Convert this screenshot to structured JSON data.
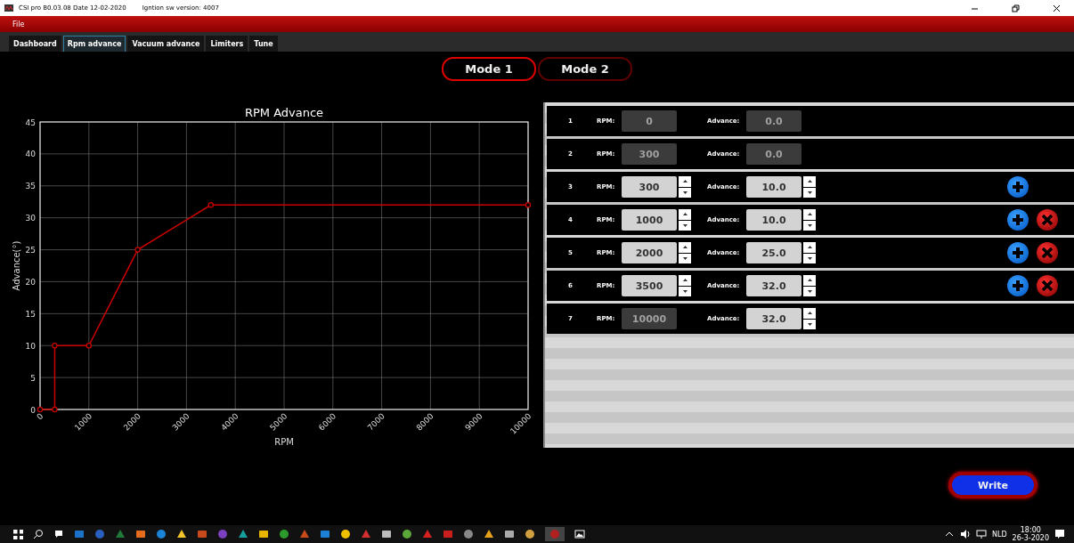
{
  "window": {
    "title": "CSI pro B0.03.08 Date 12-02-2020",
    "version": "Igntion sw version: 4007"
  },
  "menu": [
    "File"
  ],
  "tabs": [
    {
      "label": "Dashboard",
      "selected": false
    },
    {
      "label": "Rpm advance",
      "selected": true
    },
    {
      "label": "Vacuum advance",
      "selected": false
    },
    {
      "label": "Limiters",
      "selected": false
    },
    {
      "label": "Tune",
      "selected": false
    }
  ],
  "modes": [
    {
      "label": "Mode 1",
      "selected": true
    },
    {
      "label": "Mode 2",
      "selected": false
    }
  ],
  "chart": {
    "chart_data": {
      "type": "line",
      "title": "RPM Advance",
      "xlabel": "RPM",
      "ylabel": "Advance(°)",
      "x": [
        0,
        300,
        300,
        1000,
        2000,
        3500,
        10000
      ],
      "series": [
        {
          "color": "#cc0000",
          "marker": "circle",
          "values": [
            0,
            0,
            10,
            10,
            25,
            32,
            32
          ]
        }
      ],
      "grid": true,
      "xlim": [
        0,
        10000
      ],
      "ylim": [
        0,
        45
      ],
      "xticks": [
        0,
        1000,
        2000,
        3000,
        4000,
        5000,
        6000,
        7000,
        8000,
        9000,
        10000
      ],
      "yticks": [
        0,
        5,
        10,
        15,
        20,
        25,
        30,
        35,
        40,
        45
      ]
    }
  },
  "points": [
    {
      "index": "1",
      "rpm_label": "RPM:",
      "rpm": "0",
      "rpm_editable": false,
      "advance_label": "Advance:",
      "advance": "0.0",
      "advance_editable": false,
      "can_add": false,
      "can_delete": false
    },
    {
      "index": "2",
      "rpm_label": "RPM:",
      "rpm": "300",
      "rpm_editable": false,
      "advance_label": "Advance:",
      "advance": "0.0",
      "advance_editable": false,
      "can_add": false,
      "can_delete": false
    },
    {
      "index": "3",
      "rpm_label": "RPM:",
      "rpm": "300",
      "rpm_editable": true,
      "advance_label": "Advance:",
      "advance": "10.0",
      "advance_editable": true,
      "can_add": true,
      "can_delete": false
    },
    {
      "index": "4",
      "rpm_label": "RPM:",
      "rpm": "1000",
      "rpm_editable": true,
      "advance_label": "Advance:",
      "advance": "10.0",
      "advance_editable": true,
      "can_add": true,
      "can_delete": true
    },
    {
      "index": "5",
      "rpm_label": "RPM:",
      "rpm": "2000",
      "rpm_editable": true,
      "advance_label": "Advance:",
      "advance": "25.0",
      "advance_editable": true,
      "can_add": true,
      "can_delete": true
    },
    {
      "index": "6",
      "rpm_label": "RPM:",
      "rpm": "3500",
      "rpm_editable": true,
      "advance_label": "Advance:",
      "advance": "32.0",
      "advance_editable": true,
      "can_add": true,
      "can_delete": true
    },
    {
      "index": "7",
      "rpm_label": "RPM:",
      "rpm": "10000",
      "rpm_editable": false,
      "advance_label": "Advance:",
      "advance": "32.0",
      "advance_editable": true,
      "can_add": false,
      "can_delete": false
    }
  ],
  "write_button": "Write",
  "taskbar": {
    "language": "NLD",
    "time": "18:00",
    "date": "26-3-2020"
  }
}
